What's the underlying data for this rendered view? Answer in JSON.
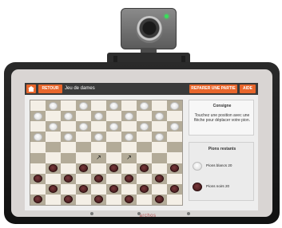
{
  "toolbar": {
    "home_icon": "home-icon",
    "back_label": "RETOUR",
    "title": "Jeu de dames",
    "restart_label": "REPARER UNE PARTIE",
    "help_label": "AIDE"
  },
  "panel": {
    "consigne_title": "Consigne",
    "consigne_text": "Touchez une position avec une flèche pour déplacer votre pion.",
    "pieces_title": "Pions restants",
    "white_label": "Pions blancs 20",
    "black_label": "Pions noirs 20"
  },
  "device": {
    "brand": "archos"
  },
  "colors": {
    "accent": "#e8662c",
    "topbar": "#3a3a3a",
    "white_piece": "#f2f2f2",
    "black_piece": "#4b1b1d",
    "dark_square": "#b3ab98"
  },
  "board": {
    "size": 10,
    "white_rows": [
      0,
      1,
      2,
      3
    ],
    "black_rows": [
      6,
      7,
      8,
      9
    ],
    "markers": [
      {
        "row": 5,
        "col": 4,
        "icon": "arrow-icon"
      },
      {
        "row": 5,
        "col": 6,
        "icon": "arrow-icon"
      }
    ]
  }
}
